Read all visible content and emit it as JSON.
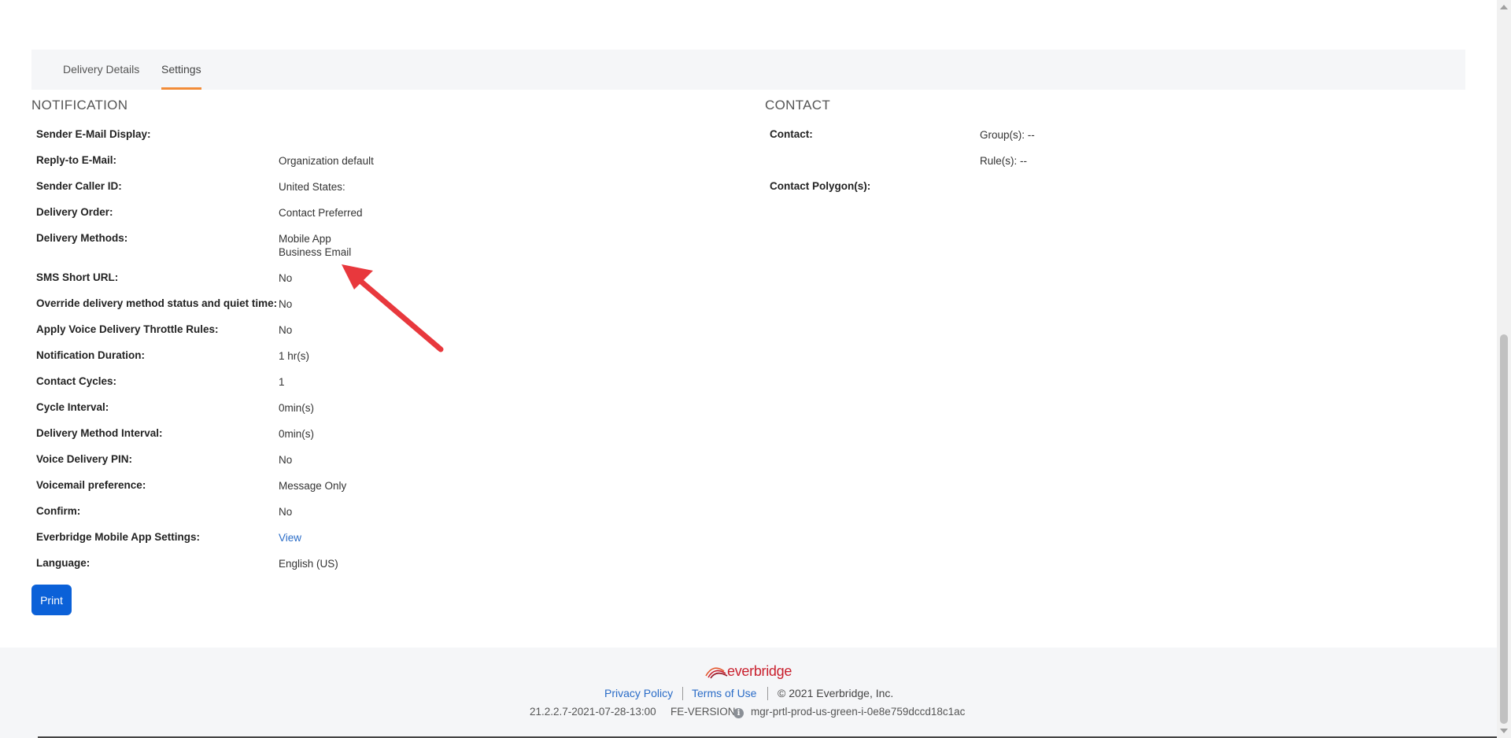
{
  "tabs": [
    {
      "label": "Delivery Details",
      "active": false
    },
    {
      "label": "Settings",
      "active": true
    }
  ],
  "notification": {
    "title": "NOTIFICATION",
    "rows": [
      {
        "label": "Sender E-Mail Display:",
        "value": ""
      },
      {
        "label": "Reply-to E-Mail:",
        "value": "Organization default"
      },
      {
        "label": "Sender Caller ID:",
        "value": "United States:"
      },
      {
        "label": "Delivery Order:",
        "value": "Contact Preferred"
      },
      {
        "label": "Delivery Methods:",
        "values": [
          "Mobile App",
          "Business Email"
        ]
      },
      {
        "label": "SMS Short URL:",
        "value": "No"
      },
      {
        "label": "Override delivery method status and quiet time:",
        "value": "No"
      },
      {
        "label": "Apply Voice Delivery Throttle Rules:",
        "value": "No"
      },
      {
        "label": "Notification Duration:",
        "value": "1 hr(s)"
      },
      {
        "label": "Contact Cycles:",
        "value": "1"
      },
      {
        "label": "Cycle Interval:",
        "value": "0min(s)"
      },
      {
        "label": "Delivery Method Interval:",
        "value": "0min(s)"
      },
      {
        "label": "Voice Delivery PIN:",
        "value": "No"
      },
      {
        "label": "Voicemail preference:",
        "value": "Message Only"
      },
      {
        "label": "Confirm:",
        "value": "No"
      },
      {
        "label": "Everbridge Mobile App Settings:",
        "value": "View"
      },
      {
        "label": "Language:",
        "value": "English (US)"
      }
    ]
  },
  "contact": {
    "title": "CONTACT",
    "rows": [
      {
        "label": "Contact:",
        "values": [
          "Group(s): --",
          "Rule(s): --"
        ]
      },
      {
        "label": "Contact Polygon(s):",
        "value": ""
      }
    ]
  },
  "actions": {
    "print_label": "Print"
  },
  "footer": {
    "logo_ever": "ever",
    "logo_bridge": "bridge",
    "privacy_label": "Privacy Policy",
    "terms_label": "Terms of Use",
    "copyright": "©  2021 Everbridge, Inc.",
    "build": "21.2.2.7-2021-07-28-13:00",
    "fe_version_label": "FE-VERSION",
    "server": "mgr-prtl-prod-us-green-i-0e8e759dccd18c1ac"
  },
  "colors": {
    "accent_tab": "#f28c38",
    "button": "#0b61d8",
    "link": "#2a6cc7",
    "brand": "#c9202e",
    "annotation_arrow": "#e8383d"
  }
}
